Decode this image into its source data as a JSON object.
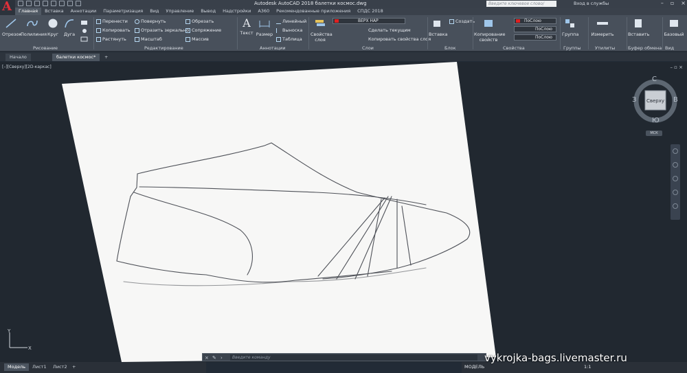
{
  "titlebar": {
    "app_title": "Autodesk AutoCAD 2018    балетки космос.dwg",
    "search_placeholder": "Введите ключевое слово/фразу",
    "sign_in": "Вход в службы"
  },
  "tabs": [
    {
      "label": "Главная",
      "active": true
    },
    {
      "label": "Вставка"
    },
    {
      "label": "Аннотации"
    },
    {
      "label": "Параметризация"
    },
    {
      "label": "Вид"
    },
    {
      "label": "Управление"
    },
    {
      "label": "Вывод"
    },
    {
      "label": "Надстройки"
    },
    {
      "label": "A360"
    },
    {
      "label": "Рекомендованные приложения"
    },
    {
      "label": "СПДС 2018"
    }
  ],
  "ribbon": {
    "draw": {
      "title": "Рисование",
      "line": "Отрезок",
      "polyline": "Полилиния",
      "circle": "Круг",
      "arc": "Дуга"
    },
    "modify": {
      "title": "Редактирование",
      "move": "Перенести",
      "rotate": "Повернуть",
      "trim": "Обрезать",
      "copy": "Копировать",
      "mirror": "Отразить зеркально",
      "fillet": "Сопряжение",
      "stretch": "Растянуть",
      "scale": "Масштаб",
      "array": "Массив"
    },
    "annotation": {
      "title": "Аннотации",
      "text": "Текст",
      "dimension": "Размер",
      "linear": "Линейный",
      "leader": "Выноска",
      "table": "Таблица"
    },
    "layers": {
      "title": "Слои",
      "layer_properties": "Свойства слоя",
      "current_layer": "ВЕРХ НАР",
      "make_current": "Сделать текущим",
      "match_layer": "Копировать свойства слоя"
    },
    "block": {
      "title": "Блок",
      "insert": "Вставка",
      "create": "Создать"
    },
    "properties": {
      "title": "Свойства",
      "match": "Копирование свойств",
      "color": "ПоСлою",
      "linetype": "ПоСлою",
      "lineweight": "ПоСлою"
    },
    "groups": {
      "title": "Группы",
      "group": "Группа"
    },
    "utilities": {
      "title": "Утилиты",
      "measure": "Измерить"
    },
    "clipboard": {
      "title": "Буфер обмена",
      "paste": "Вставить"
    },
    "view": {
      "title": "Вид",
      "base": "Базовый"
    }
  },
  "filetabs": {
    "start": "Начало",
    "file": "балетки космос*",
    "add": "+"
  },
  "viewport": {
    "label": "[–][Сверху][2D-каркас]",
    "controls": "– ▫ ×"
  },
  "viewcube": {
    "north": "С",
    "south": "Ю",
    "west": "З",
    "east": "В",
    "face": "Сверху",
    "wcs": "МСК"
  },
  "ucs": {
    "x": "X",
    "y": "Y"
  },
  "layout_tabs": [
    {
      "label": "Модель",
      "active": true
    },
    {
      "label": "Лист1"
    },
    {
      "label": "Лист2"
    },
    {
      "label": "+"
    }
  ],
  "command_line": {
    "placeholder": "Введите команду"
  },
  "statusbar": {
    "mode": "МОДЕЛЬ",
    "scale": "1:1"
  },
  "watermark": "vykrojka-bags.livemaster.ru",
  "colors": {
    "background": "#212830",
    "ribbon": "#48505b",
    "current_layer": "#e02020",
    "accent_red": "#e0303a"
  }
}
